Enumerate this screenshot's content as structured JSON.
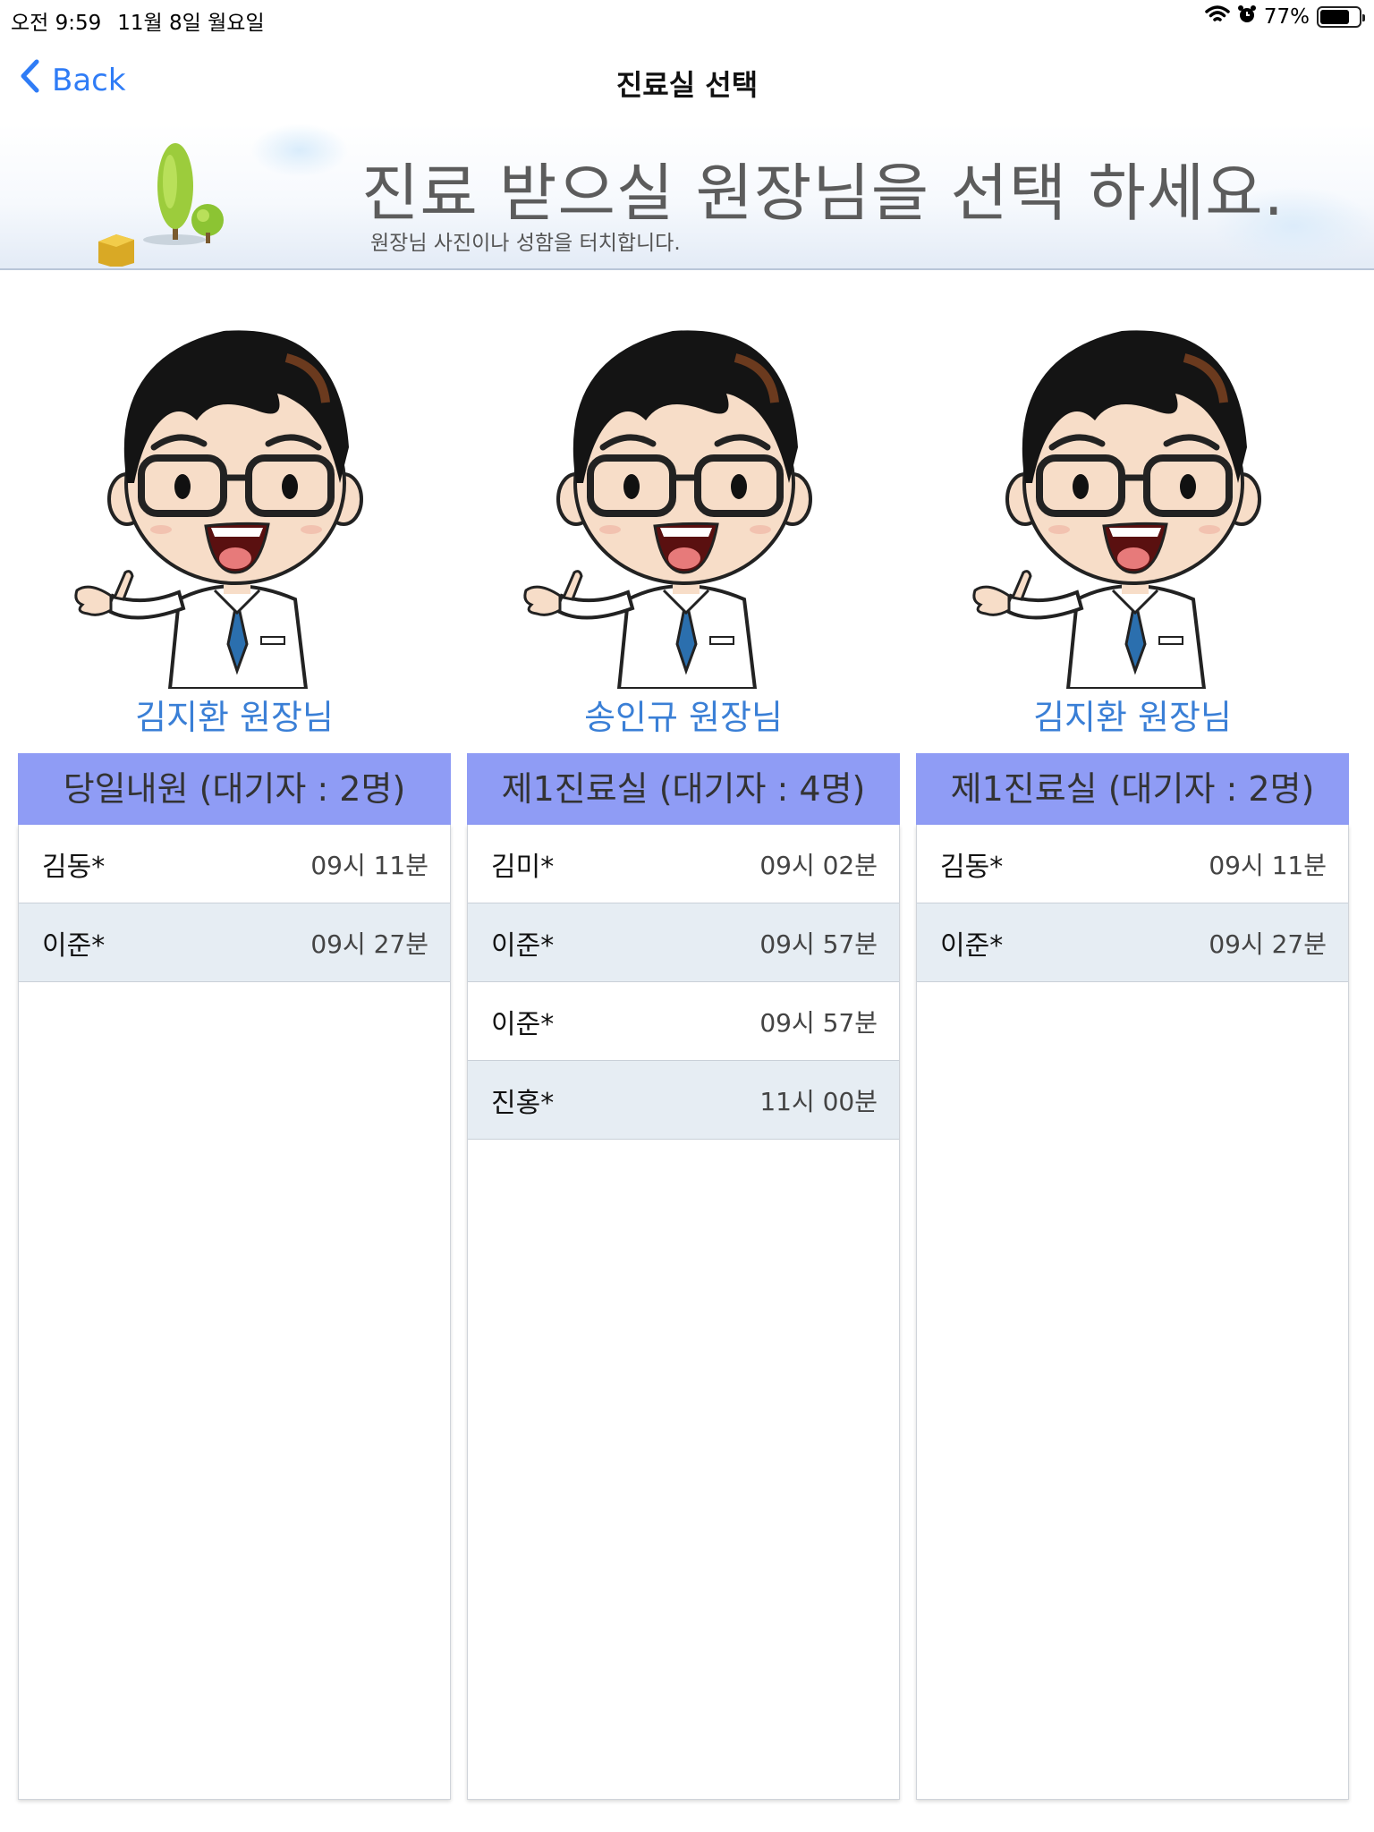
{
  "status_bar": {
    "time": "오전 9:59",
    "date": "11월 8일 월요일",
    "battery": "77%",
    "battery_level": 0.77
  },
  "nav": {
    "back_label": "Back",
    "title": "진료실 선택"
  },
  "banner": {
    "headline": "진료 받으실 원장님을 선택 하세요.",
    "subtext": "원장님 사진이나 성함을 터치합니다."
  },
  "doctors": [
    {
      "name": "김지환 원장님",
      "room": "당일내원 (대기자 : 2명)",
      "patients": [
        {
          "name": "김동*",
          "time": "09시 11분"
        },
        {
          "name": "이준*",
          "time": "09시 27분"
        }
      ]
    },
    {
      "name": "송인규 원장님",
      "room": "제1진료실 (대기자 : 4명)",
      "patients": [
        {
          "name": "김미*",
          "time": "09시 02분"
        },
        {
          "name": "이준*",
          "time": "09시 57분"
        },
        {
          "name": "이준*",
          "time": "09시 57분"
        },
        {
          "name": "진홍*",
          "time": "11시 00분"
        }
      ]
    },
    {
      "name": "김지환 원장님",
      "room": "제1진료실 (대기자 : 2명)",
      "patients": [
        {
          "name": "김동*",
          "time": "09시 11분"
        },
        {
          "name": "이준*",
          "time": "09시 27분"
        }
      ]
    }
  ]
}
